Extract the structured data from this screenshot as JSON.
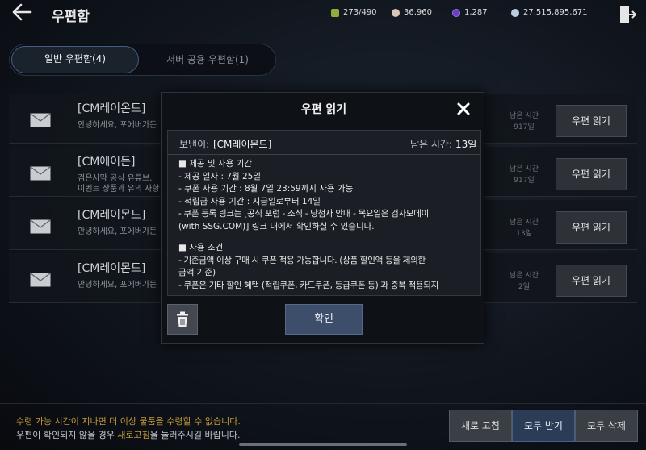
{
  "header": {
    "title": "우편함",
    "back_icon": "arrow-left-icon",
    "exit_icon": "exit-door-icon",
    "currencies": [
      {
        "name": "inventory-icon",
        "value": "273/490",
        "color": "#8fae3a"
      },
      {
        "name": "pearl-icon",
        "value": "36,960",
        "color": "#d9c6b8"
      },
      {
        "name": "purple-gem-icon",
        "value": "1,287",
        "color": "#6a3cc8"
      },
      {
        "name": "silver-coin-icon",
        "value": "27,515,895,671",
        "color": "#b8cde0"
      }
    ]
  },
  "tabs": [
    {
      "label": "일반 우편함(4)",
      "active": true
    },
    {
      "label": "서버 공용 우편함(1)",
      "active": false
    }
  ],
  "mails": [
    {
      "sender": "[CM레이온드]",
      "preview": "안녕하세요, 포에버가든",
      "preview2": "",
      "remaining_label": "남은 시간",
      "remaining": "917일",
      "button": "우편 읽기"
    },
    {
      "sender": "[CM에이든]",
      "preview": "검은사막 공식 유튜브,",
      "preview2": "이벤트 상품과 유의 사항",
      "remaining_label": "남은 시간",
      "remaining": "917일",
      "button": "우편 읽기"
    },
    {
      "sender": "[CM레이몬드]",
      "preview": "안녕하세요, 포에버가든",
      "preview2": "",
      "remaining_label": "남은 시간",
      "remaining": "13일",
      "button": "우편 읽기"
    },
    {
      "sender": "[CM레이몬드]",
      "preview": "안녕하세요, 포에버가든",
      "preview2": "",
      "remaining_label": "남은 시간",
      "remaining": "2일",
      "button": "우편 읽기"
    }
  ],
  "modal": {
    "title": "우편 읽기",
    "from_label": "보낸이:",
    "from_value": "[CM레이몬드]",
    "remaining_label": "남은 시간:",
    "remaining_value": "13일",
    "lines": [
      "■ 제공 및 사용 기간",
      "- 제공 일자 : 7월 25일",
      "- 쿠폰 사용 기간 : 8월 7일 23:59까지 사용 가능",
      "- 적립금 사용 기간 : 지급일로부터 14일",
      "- 쿠폰 등록 링크는 [공식 포럼 - 소식 - 당첨자 안내 - 목요일은 검사모데이",
      "(with SSG.COM)] 링크 내에서 확인하실 수 있습니다.",
      "",
      "■ 사용 조건",
      "- 기준금액 이상 구매 시 쿠폰 적용 가능합니다. (상품 할인액 등을 제외한",
      "금액 기준)",
      "- 쿠폰은 기타 할인 혜택 (적립쿠폰, 카드쿠폰, 등급쿠폰 등) 과 중복 적용되지"
    ],
    "confirm_label": "확인",
    "close_icon": "close-icon",
    "trash_icon": "trash-icon"
  },
  "footer": {
    "notice1": "수령 가능 시간이 지나면 더 이상 물품을 수령할 수 없습니다.",
    "notice2_pre": "우편이 확인되지 않을 경우 ",
    "notice2_hl": "새로고침",
    "notice2_post": "을 눌러주시길 바랍니다.",
    "refresh_label": "새로 고침",
    "receive_all_label": "모두 받기",
    "delete_all_label": "모두 삭제"
  }
}
